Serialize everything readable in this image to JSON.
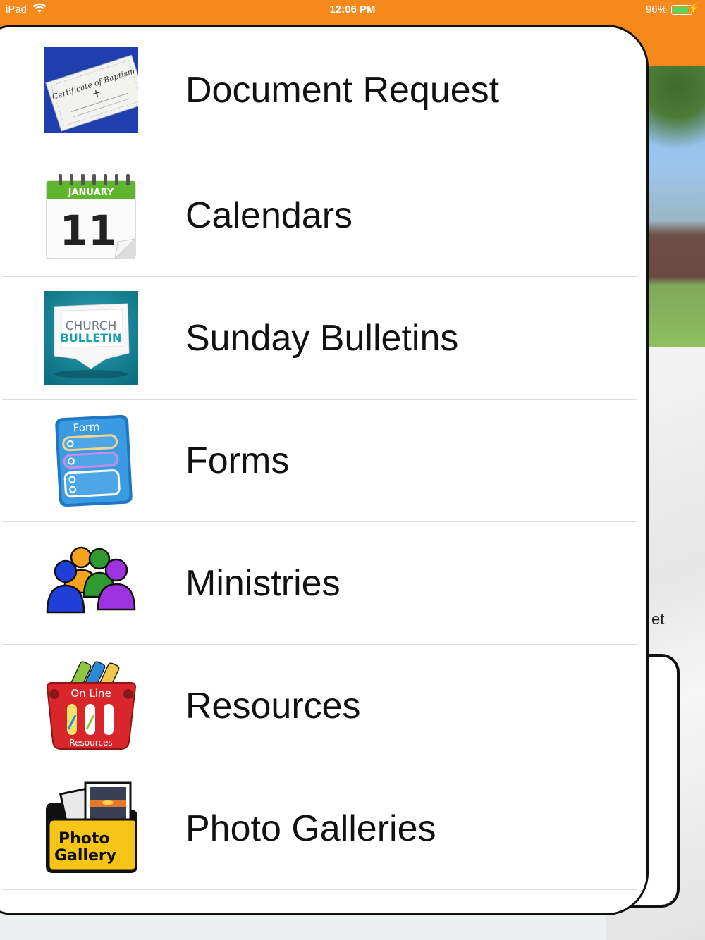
{
  "status_bar": {
    "device": "iPad",
    "time": "12:06 PM",
    "battery_percent": "96%",
    "battery_level": 0.96
  },
  "menu": {
    "items": [
      {
        "label": "Document Request",
        "icon": "baptism-certificate-icon",
        "icon_text": [
          "Certificate of Baptism"
        ]
      },
      {
        "label": "Calendars",
        "icon": "calendar-icon",
        "icon_text": [
          "JANUARY",
          "11"
        ]
      },
      {
        "label": "Sunday Bulletins",
        "icon": "church-bulletin-icon",
        "icon_text": [
          "CHURCH",
          "BULLETIN"
        ]
      },
      {
        "label": "Forms",
        "icon": "form-icon",
        "icon_text": [
          "Form"
        ]
      },
      {
        "label": "Ministries",
        "icon": "people-group-icon",
        "icon_text": []
      },
      {
        "label": "Resources",
        "icon": "online-resources-basket-icon",
        "icon_text": [
          "On Line",
          "Resources"
        ]
      },
      {
        "label": "Photo Galleries",
        "icon": "photo-gallery-folder-icon",
        "icon_text": [
          "Photo",
          "Gallery"
        ]
      }
    ]
  },
  "background": {
    "partial_text": "et"
  },
  "colors": {
    "status_bar": "#f5891c",
    "battery": "#4cd964"
  }
}
